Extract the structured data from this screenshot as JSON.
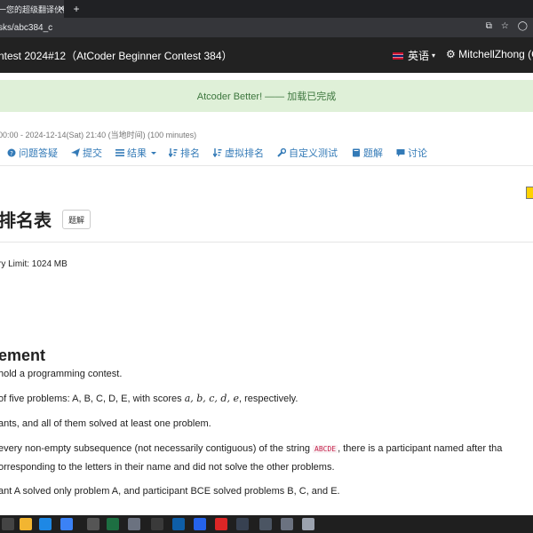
{
  "browser": {
    "tab_title": "一您的超级翻译伙伴",
    "tab_close": "✕",
    "new_tab": "+",
    "url": "sks/abc384_c"
  },
  "header": {
    "contest_title": "ntest 2024#12（AtCoder Beginner Contest 384）",
    "language_label": "英语",
    "username": "MitchellZhong (Co"
  },
  "banner": {
    "text": "Atcoder Better! —— 加载已完成"
  },
  "contest_time": "00:00 - 2024-12-14(Sat) 21:40 (当地时间) (100 minutes)",
  "nav": {
    "items": [
      {
        "label": "问题答疑"
      },
      {
        "label": "提交"
      },
      {
        "label": "结果"
      },
      {
        "label": "排名"
      },
      {
        "label": "虚拟排名"
      },
      {
        "label": "自定义测试"
      },
      {
        "label": "题解"
      },
      {
        "label": "讨论"
      }
    ]
  },
  "page": {
    "title": "排名表",
    "editorial_button": "题解",
    "memory_limit": "ry Limit: 1024 MB",
    "section_title": "ement"
  },
  "statement": {
    "line1": "hold a programming contest.",
    "line2_a": "of five problems: A, B, C, D, E, with scores ",
    "line2_math": "a, b, c, d, e",
    "line2_b": ", respectively.",
    "line3": "ants, and all of them solved at least one problem.",
    "line4_a": "every non-empty subsequence (not necessarily contiguous) of the string ",
    "line4_code": "ABCDE",
    "line4_b": ", there is a participant named after tha",
    "line5": "orresponding to the letters in their name and did not solve the other problems.",
    "line6": "ant A solved only problem A, and participant BCE solved problems B, C, and E."
  },
  "colors": {
    "link": "#337ab7",
    "header_bg": "#222222",
    "banner_bg": "#dff0d8",
    "banner_text": "#3c763d"
  }
}
